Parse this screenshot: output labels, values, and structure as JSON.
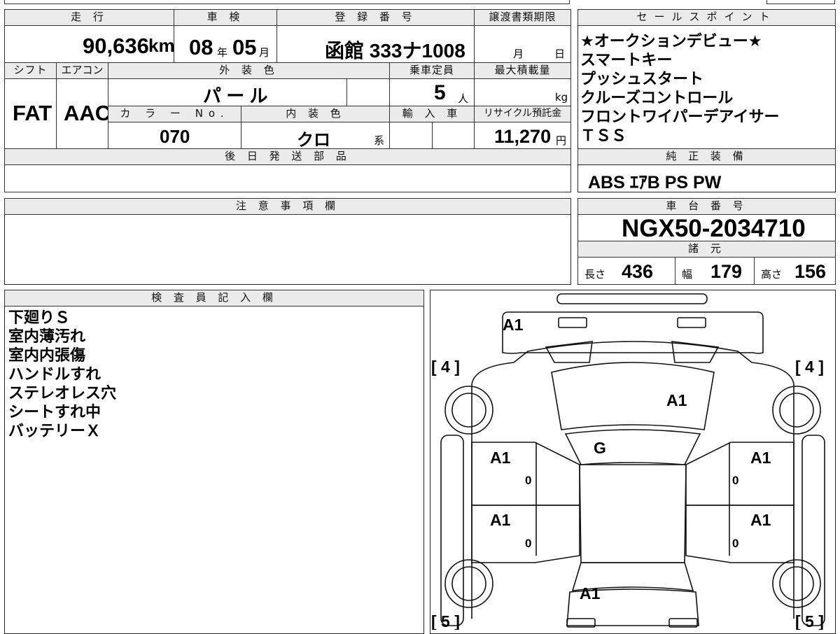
{
  "top_table": {
    "mileage_header": "走 行",
    "mileage_value": "90,636",
    "mileage_unit": "km",
    "inspection_header": "車 検",
    "inspection_year": "08",
    "inspection_year_unit": "年",
    "inspection_month": "05",
    "inspection_month_unit": "月",
    "plate_header": "登 録 番 号",
    "plate_value": "函館 333ナ1008",
    "transfer_header": "譲渡書類期限",
    "transfer_month_unit": "月",
    "transfer_day_unit": "日",
    "shift_header": "シフト",
    "shift_value": "FAT",
    "ac_header": "エアコン",
    "ac_value": "AAC",
    "exterior_header": "外 装 色",
    "exterior_value": "パ ー ル",
    "capacity_header": "乗車定員",
    "capacity_value": "5",
    "capacity_unit": "人",
    "maxload_header": "最大積載量",
    "maxload_unit": "kg",
    "colorno_header": "カ ラ ー No.",
    "colorno_value": "070",
    "interior_header": "内 装 色",
    "interior_value": "クロ",
    "interior_unit": "系",
    "import_header": "輸 入 車",
    "recycle_header": "リサイクル預託金",
    "recycle_value": "11,270",
    "recycle_unit": "円",
    "later_parts_header": "後 日 発 送 部 品"
  },
  "sales_points": {
    "header": "セールスポイント",
    "items": [
      "★オークションデビュー★",
      "スマートキー",
      "プッシュスタート",
      "クルーズコントロール",
      "フロントワイパーデアイサー",
      "ＴＳＳ"
    ]
  },
  "standard_equipment": {
    "header": "純 正 装 備",
    "value": "ABS ｴｱB PS PW"
  },
  "notes": {
    "header": "注 意 事 項 欄"
  },
  "chassis": {
    "header": "車 台 番 号",
    "value": "NGX50-2034710",
    "specs_header": "諸 元",
    "length_label": "長さ",
    "length_value": "436",
    "width_label": "幅",
    "width_value": "179",
    "height_label": "高さ",
    "height_value": "156"
  },
  "inspector": {
    "header": "検 査 員 記 入 欄",
    "lines": [
      "下廻りＳ",
      "室内薄汚れ",
      "室内内張傷",
      "ハンドルすれ",
      "ステレオレス穴",
      "シートすれ中",
      "バッテリーＸ"
    ]
  },
  "diagram": {
    "tire_front_left": "[ 4 ]",
    "tire_front_right": "[ 4 ]",
    "tire_rear_left": "[ 5 ]",
    "tire_rear_right": "[ 5 ]",
    "mark_front_bumper": "A1",
    "mark_hood": "A1",
    "mark_windshield": "G",
    "mark_front_left_door": "A1",
    "mark_front_right_door": "A1",
    "mark_rear_left_door": "A1",
    "mark_rear_right_door": "A1",
    "mark_rear": "A1",
    "handle_mark": "0"
  }
}
